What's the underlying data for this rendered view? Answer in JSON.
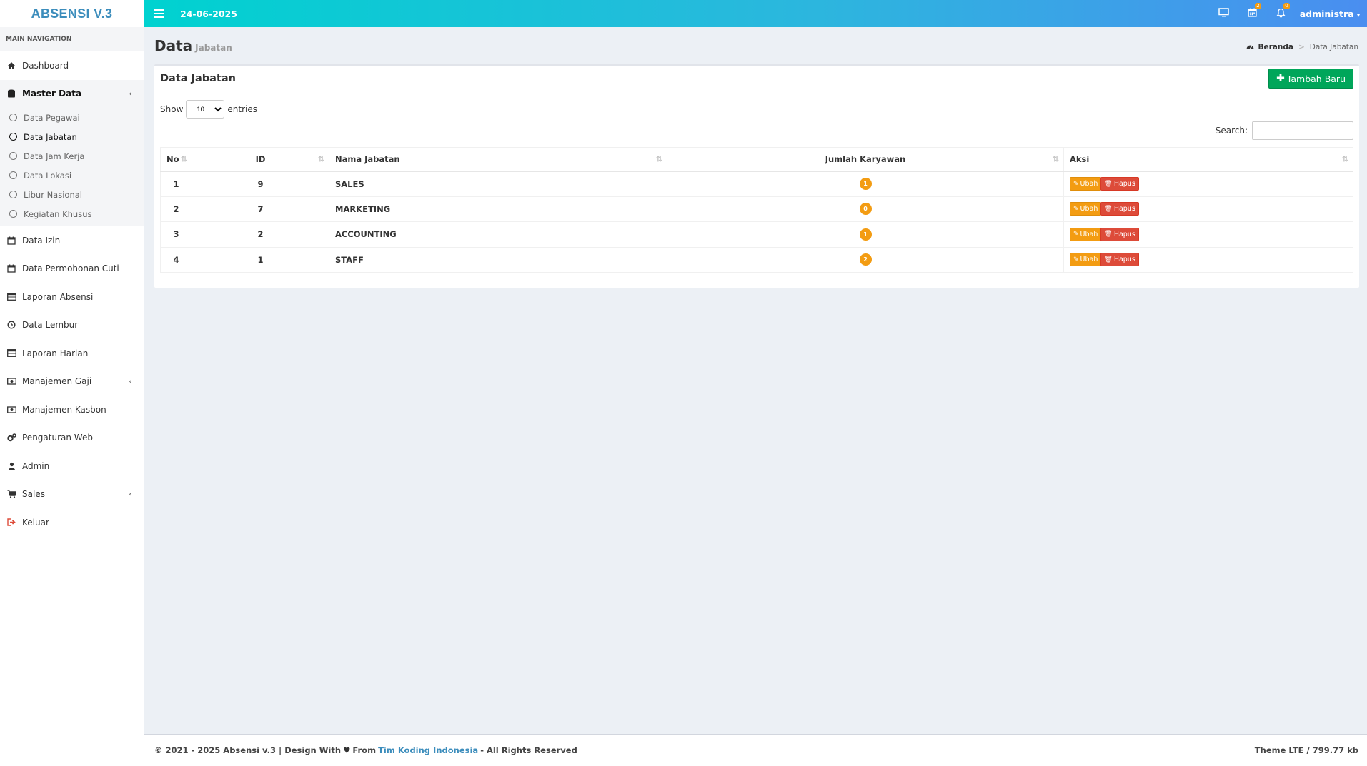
{
  "app": {
    "logo": "ABSENSI V.3"
  },
  "sidebar": {
    "header": "MAIN NAVIGATION",
    "items": [
      {
        "label": "Dashboard",
        "icon": "home-icon"
      },
      {
        "label": "Master Data",
        "icon": "database-icon",
        "expanded": true
      },
      {
        "label": "Data Izin",
        "icon": "calendar-icon"
      },
      {
        "label": "Data Permohonan Cuti",
        "icon": "calendar-icon"
      },
      {
        "label": "Laporan Absensi",
        "icon": "table-icon"
      },
      {
        "label": "Data Lembur",
        "icon": "clock-icon"
      },
      {
        "label": "Laporan Harian",
        "icon": "table-icon"
      },
      {
        "label": "Manajemen Gaji",
        "icon": "money-icon"
      },
      {
        "label": "Manajemen Kasbon",
        "icon": "money-icon"
      },
      {
        "label": "Pengaturan Web",
        "icon": "cogs-icon"
      },
      {
        "label": "Admin",
        "icon": "user-icon"
      },
      {
        "label": "Sales",
        "icon": "cart-icon"
      },
      {
        "label": "Keluar",
        "icon": "sign-out-icon"
      }
    ],
    "master_sub": [
      "Data Pegawai",
      "Data Jabatan",
      "Data Jam Kerja",
      "Data Lokasi",
      "Libur Nasional",
      "Kegiatan Khusus"
    ],
    "active_sub": "Data Jabatan"
  },
  "topbar": {
    "date": "24-06-2025",
    "calendar_badge": "2",
    "bell_badge": "0",
    "user": "administra"
  },
  "page": {
    "title": "Data",
    "subtitle": "Jabatan",
    "breadcrumb_home": "Beranda",
    "breadcrumb_current": "Data Jabatan"
  },
  "box": {
    "title": "Data Jabatan",
    "add_button": "Tambah Baru",
    "show_label": "Show",
    "entries_label": "entries",
    "length_value": "10",
    "search_label": "Search:"
  },
  "table": {
    "headers": [
      "No",
      "ID",
      "Nama Jabatan",
      "Jumlah Karyawan",
      "Aksi"
    ],
    "rows": [
      {
        "no": "1",
        "id": "9",
        "nama": "SALES",
        "jumlah": "1"
      },
      {
        "no": "2",
        "id": "7",
        "nama": "MARKETING",
        "jumlah": "0"
      },
      {
        "no": "3",
        "id": "2",
        "nama": "ACCOUNTING",
        "jumlah": "1"
      },
      {
        "no": "4",
        "id": "1",
        "nama": "STAFF",
        "jumlah": "2"
      }
    ],
    "edit_label": "Ubah",
    "delete_label": "Hapus"
  },
  "footer": {
    "left_1": "© 2021 - 2025 Absensi v.3 | Design With",
    "left_2": "From",
    "link": "Tim Koding Indonesia",
    "left_3": "- All Rights Reserved",
    "right": "Theme LTE / 799.77 kb"
  }
}
